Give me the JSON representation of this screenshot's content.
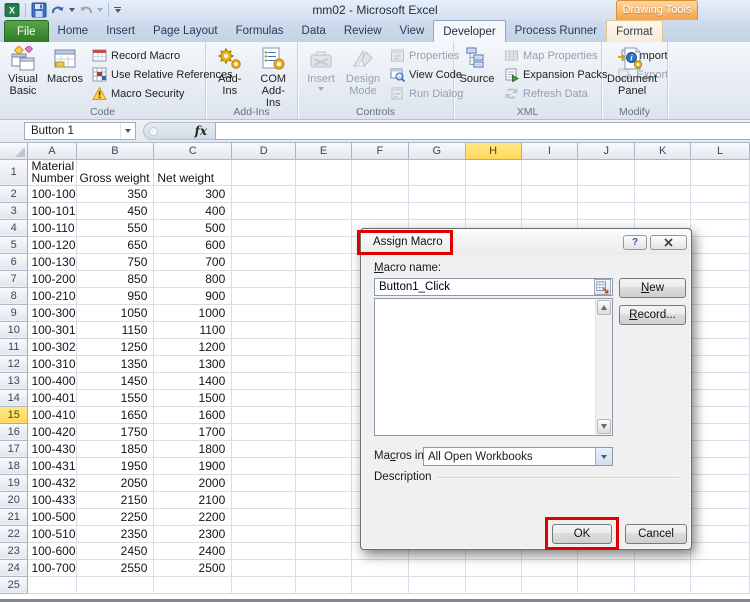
{
  "window": {
    "title": "mm02  -  Microsoft Excel",
    "contextual_group": "Drawing Tools"
  },
  "tabs": [
    {
      "label": "File",
      "type": "file"
    },
    {
      "label": "Home",
      "type": "normal"
    },
    {
      "label": "Insert",
      "type": "normal"
    },
    {
      "label": "Page Layout",
      "type": "normal"
    },
    {
      "label": "Formulas",
      "type": "normal"
    },
    {
      "label": "Data",
      "type": "normal"
    },
    {
      "label": "Review",
      "type": "normal"
    },
    {
      "label": "View",
      "type": "normal"
    },
    {
      "label": "Developer",
      "type": "active"
    },
    {
      "label": "Process Runner",
      "type": "normal"
    },
    {
      "label": "Format",
      "type": "contextual"
    }
  ],
  "ribbon": {
    "groups": [
      {
        "label": "Code",
        "large": [
          {
            "label": "Visual\nBasic",
            "icon": "visual-basic-icon",
            "enabled": true,
            "name": "visual-basic"
          },
          {
            "label": "Macros",
            "icon": "macros-icon",
            "enabled": true,
            "name": "macros"
          }
        ],
        "small_columns": [
          [
            {
              "label": "Record Macro",
              "icon": "record-macro-icon",
              "enabled": true,
              "name": "record-macro"
            },
            {
              "label": "Use Relative References",
              "icon": "relative-references-icon",
              "enabled": true,
              "name": "use-relative-references"
            },
            {
              "label": "Macro Security",
              "icon": "macro-security-icon",
              "enabled": true,
              "name": "macro-security"
            }
          ]
        ]
      },
      {
        "label": "Add-Ins",
        "large": [
          {
            "label": "Add-Ins",
            "icon": "addins-gears-icon",
            "enabled": true,
            "name": "add-ins"
          },
          {
            "label": "COM\nAdd-Ins",
            "icon": "com-addins-icon",
            "enabled": true,
            "name": "com-add-ins"
          }
        ],
        "small_columns": []
      },
      {
        "label": "Controls",
        "large": [
          {
            "label": "Insert",
            "icon": "insert-controls-icon",
            "enabled": false,
            "dropdown": true,
            "name": "insert-control"
          },
          {
            "label": "Design\nMode",
            "icon": "design-mode-icon",
            "enabled": false,
            "name": "design-mode"
          }
        ],
        "small_columns": [
          [
            {
              "label": "Properties",
              "icon": "properties-icon",
              "enabled": false,
              "name": "properties"
            },
            {
              "label": "View Code",
              "icon": "view-code-icon",
              "enabled": true,
              "name": "view-code"
            },
            {
              "label": "Run Dialog",
              "icon": "run-dialog-icon",
              "enabled": false,
              "name": "run-dialog"
            }
          ]
        ]
      },
      {
        "label": "XML",
        "large": [
          {
            "label": "Source",
            "icon": "xml-source-icon",
            "enabled": true,
            "name": "source"
          }
        ],
        "small_columns": [
          [
            {
              "label": "Map Properties",
              "icon": "map-properties-icon",
              "enabled": false,
              "name": "map-properties"
            },
            {
              "label": "Expansion Packs",
              "icon": "expansion-packs-icon",
              "enabled": true,
              "name": "expansion-packs"
            },
            {
              "label": "Refresh Data",
              "icon": "refresh-data-icon",
              "enabled": false,
              "name": "refresh-data"
            }
          ],
          [
            {
              "label": "Import",
              "icon": "import-icon",
              "enabled": true,
              "name": "import"
            },
            {
              "label": "Export",
              "icon": "export-icon",
              "enabled": false,
              "name": "export"
            }
          ]
        ]
      },
      {
        "label": "Modify",
        "large": [
          {
            "label": "Document\nPanel",
            "icon": "document-panel-icon",
            "enabled": true,
            "name": "document-panel"
          }
        ],
        "small_columns": []
      }
    ]
  },
  "formula_bar": {
    "name_box_value": "Button 1",
    "fx_label": "fx",
    "formula_value": ""
  },
  "sheet": {
    "column_letters": [
      "A",
      "B",
      "C",
      "D",
      "E",
      "F",
      "G",
      "H",
      "I",
      "J",
      "K",
      "L"
    ],
    "highlighted_column": "H",
    "highlighted_row": 15,
    "cells_row1": [
      "Material\nNumber",
      "Gross weight",
      "Net weight"
    ],
    "first_data_row_number": 2,
    "data_rows": [
      [
        "100-100",
        "350",
        "300"
      ],
      [
        "100-101",
        "450",
        "400"
      ],
      [
        "100-110",
        "550",
        "500"
      ],
      [
        "100-120",
        "650",
        "600"
      ],
      [
        "100-130",
        "750",
        "700"
      ],
      [
        "100-200",
        "850",
        "800"
      ],
      [
        "100-210",
        "950",
        "900"
      ],
      [
        "100-300",
        "1050",
        "1000"
      ],
      [
        "100-301",
        "1150",
        "1100"
      ],
      [
        "100-302",
        "1250",
        "1200"
      ],
      [
        "100-310",
        "1350",
        "1300"
      ],
      [
        "100-400",
        "1450",
        "1400"
      ],
      [
        "100-401",
        "1550",
        "1500"
      ],
      [
        "100-410",
        "1650",
        "1600"
      ],
      [
        "100-420",
        "1750",
        "1700"
      ],
      [
        "100-430",
        "1850",
        "1800"
      ],
      [
        "100-431",
        "1950",
        "1900"
      ],
      [
        "100-432",
        "2050",
        "2000"
      ],
      [
        "100-433",
        "2150",
        "2100"
      ],
      [
        "100-500",
        "2250",
        "2200"
      ],
      [
        "100-510",
        "2350",
        "2300"
      ],
      [
        "100-600",
        "2450",
        "2400"
      ],
      [
        "100-700",
        "2550",
        "2500"
      ]
    ]
  },
  "dialog": {
    "title": "Assign Macro",
    "help_glyph": "?",
    "macro_name_label": {
      "pre": "",
      "accel": "M",
      "post": "acro name:"
    },
    "macro_name_value": "Button1_Click",
    "new_button": {
      "pre": "",
      "accel": "N",
      "post": "ew"
    },
    "record_button": {
      "pre": "",
      "accel": "R",
      "post": "ecord..."
    },
    "macros_in_label": {
      "pre": "Ma",
      "accel": "c",
      "post": "ros in:"
    },
    "macros_in_value": "All Open Workbooks",
    "description_label": "Description",
    "ok_label": "OK",
    "cancel_label": "Cancel"
  },
  "colors": {
    "annotation": "#e00000",
    "header_highlight": "#ffe066",
    "contextual_tab": "#f5a243",
    "file_tab": "#3c8a2f"
  }
}
